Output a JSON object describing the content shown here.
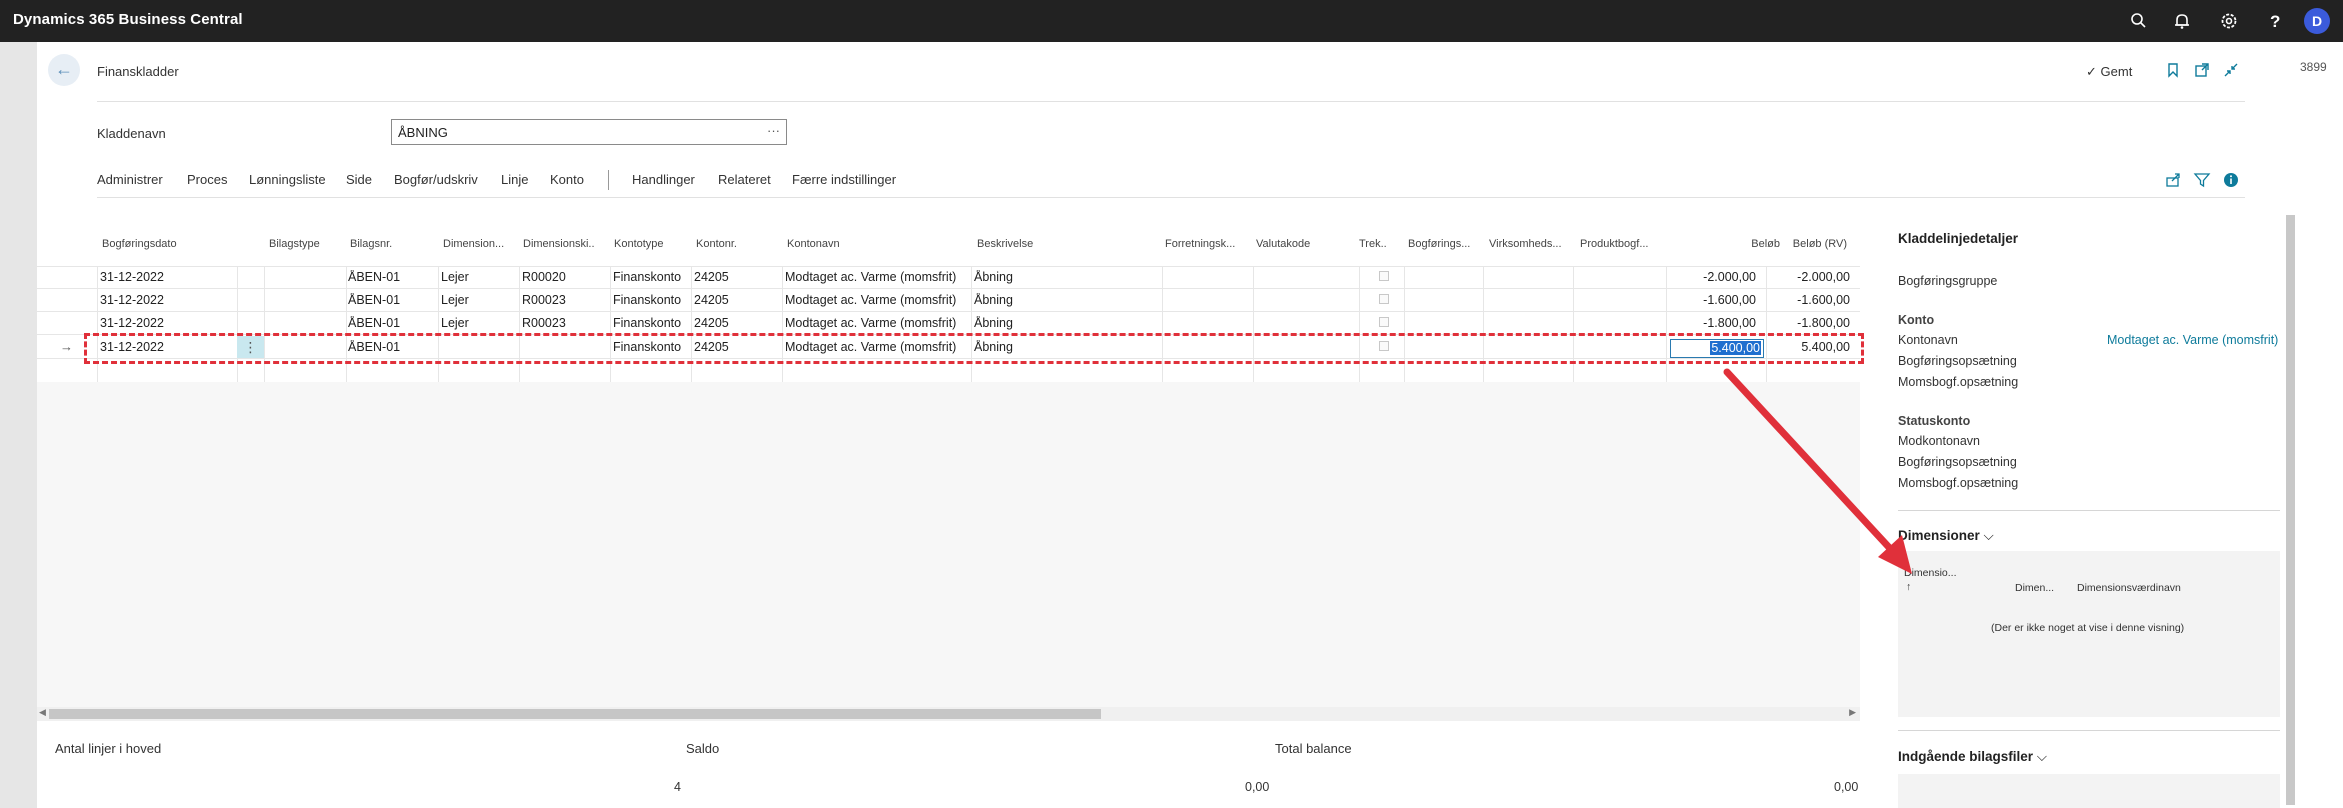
{
  "app": {
    "title": "Dynamics 365 Business Central",
    "user_initial": "D"
  },
  "topbar_icons": [
    "search-icon",
    "bell-icon",
    "gear-icon",
    "help-icon"
  ],
  "page": {
    "breadcrumb": "Finanskladder",
    "saved_label": "Gemt",
    "side_number": "3899",
    "journal_field": {
      "label": "Kladdenavn",
      "value": "ÅBNING"
    }
  },
  "actions": [
    "Administrer",
    "Proces",
    "Lønningsliste",
    "Side",
    "Bogfør/udskriv",
    "Linje",
    "Konto",
    "Handlinger",
    "Relateret",
    "Færre indstillinger"
  ],
  "grid": {
    "headers": [
      "Bogføringsdato",
      "Bilagstype",
      "Bilagsnr.",
      "Dimension...",
      "Dimensionski...",
      "Kontotype",
      "Kontonr.",
      "Kontonavn",
      "Beskrivelse",
      "Forretningsk...",
      "Valutakode",
      "Trek...",
      "Bogførings...",
      "Virksomheds...",
      "Produktbogf...",
      "Beløb",
      "Beløb (RV)"
    ],
    "rows": [
      [
        "31-12-2022",
        "",
        "ÅBEN-01",
        "Lejer",
        "R00020",
        "Finanskonto",
        "24205",
        "Modtaget ac. Varme (momsfrit)",
        "Åbning",
        "",
        "",
        "",
        "",
        "",
        "",
        "-2.000,00",
        "-2.000,00"
      ],
      [
        "31-12-2022",
        "",
        "ÅBEN-01",
        "Lejer",
        "R00023",
        "Finanskonto",
        "24205",
        "Modtaget ac. Varme (momsfrit)",
        "Åbning",
        "",
        "",
        "",
        "",
        "",
        "",
        "-1.600,00",
        "-1.600,00"
      ],
      [
        "31-12-2022",
        "",
        "ÅBEN-01",
        "Lejer",
        "R00023",
        "Finanskonto",
        "24205",
        "Modtaget ac. Varme (momsfrit)",
        "Åbning",
        "",
        "",
        "",
        "",
        "",
        "",
        "-1.800,00",
        "-1.800,00"
      ],
      [
        "31-12-2022",
        "",
        "ÅBEN-01",
        "",
        "",
        "Finanskonto",
        "24205",
        "Modtaget ac. Varme (momsfrit)",
        "Åbning",
        "",
        "",
        "",
        "",
        "",
        "",
        "5.400,00",
        "5.400,00"
      ]
    ]
  },
  "totals": {
    "lines_label": "Antal linjer i hoved",
    "lines_value": "4",
    "saldo_label": "Saldo",
    "saldo_value": "0,00",
    "balance_label": "Total balance",
    "balance_value": "0,00"
  },
  "factbox": {
    "title": "Kladdelinjedetaljer",
    "posting_group": "Bogføringsgruppe",
    "konto_title": "Konto",
    "kontonavn_label": "Kontonavn",
    "kontonavn_value": "Modtaget ac. Varme (momsfrit)",
    "bogf_opsaetning": "Bogføringsopsætning",
    "moms_opsaetning": "Momsbogf.opsætning",
    "status_title": "Statuskonto",
    "modkonto": "Modkontonavn",
    "status_bogf": "Bogføringsopsætning",
    "status_moms": "Momsbogf.opsætning",
    "dim_title": "Dimensioner",
    "dim_col1": "Dimensio...",
    "dim_col1_sort": "↑",
    "dim_col2": "Dimen...",
    "dim_col3": "Dimensionsværdinavn",
    "dim_empty": "(Der er ikke noget at vise i denne visning)",
    "incoming_title": "Indgående bilagsfiler"
  },
  "annotation_color": "#e0303a"
}
